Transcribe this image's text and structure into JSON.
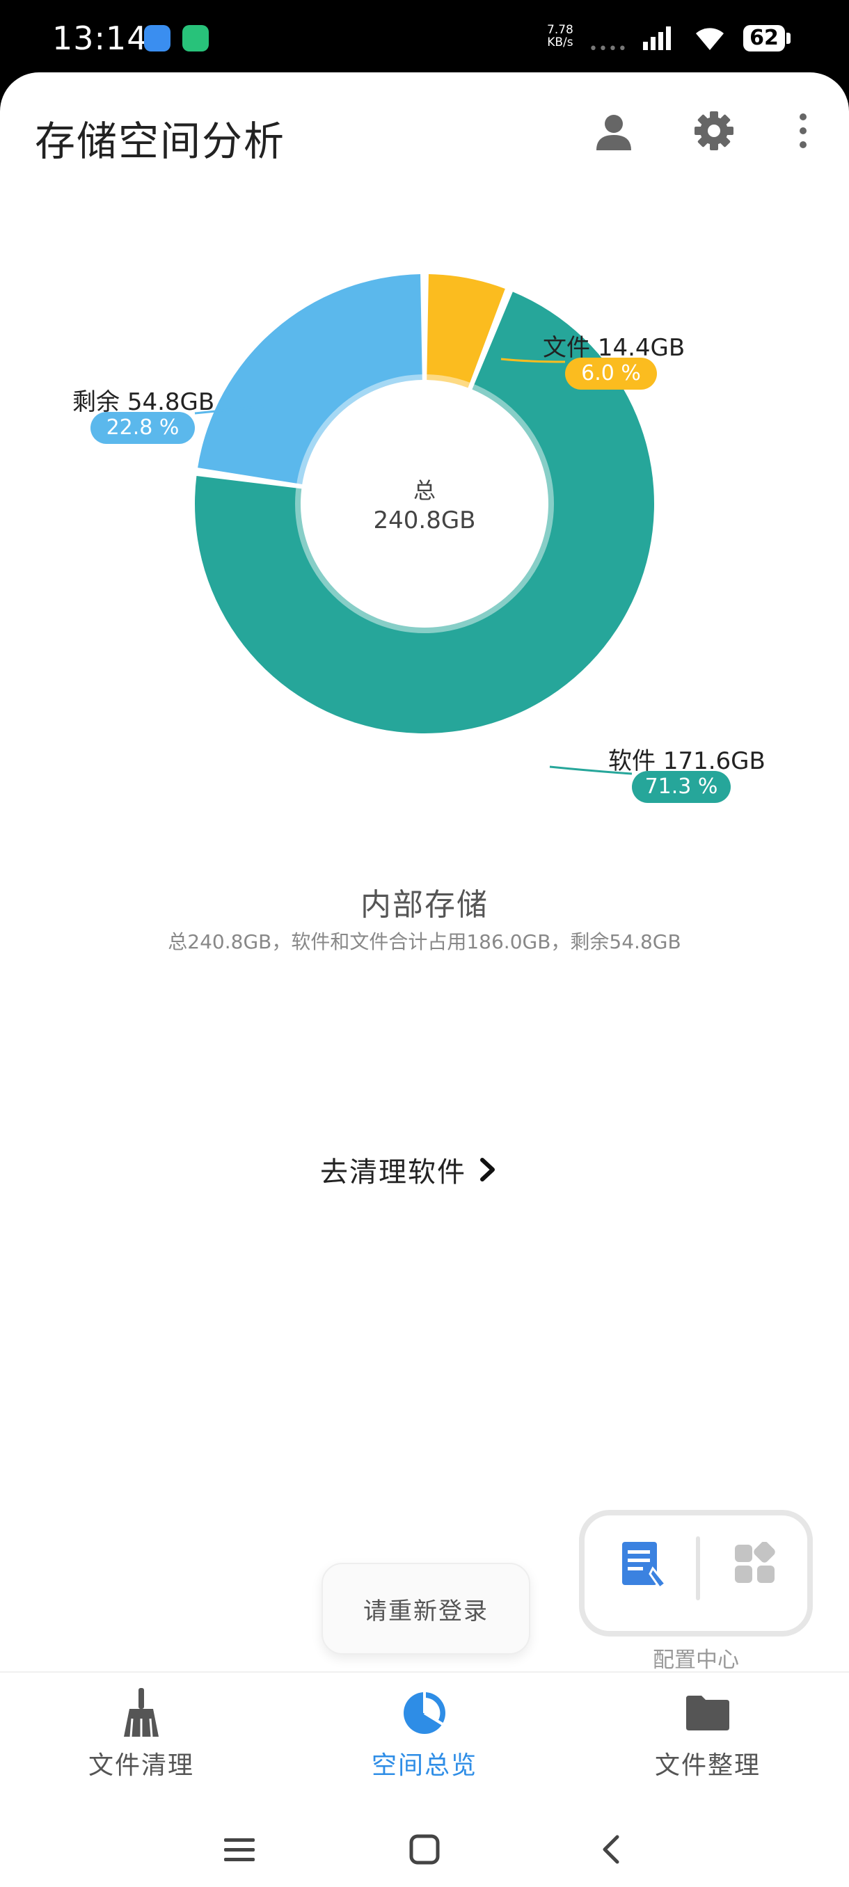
{
  "status_bar": {
    "time": "13:14",
    "net_speed_value": "7.78",
    "net_speed_unit": "KB/s",
    "battery": "62"
  },
  "header": {
    "title": "存储空间分析",
    "icons": [
      "user-icon",
      "gear-icon",
      "more-vert-icon"
    ]
  },
  "chart_data": {
    "type": "pie",
    "center_title": "总",
    "center_value": "240.8GB",
    "slices": [
      {
        "name": "文件",
        "size_label": "14.4GB",
        "percent": 6.0,
        "percent_label": "6.0 %",
        "color": "#FBBC1F"
      },
      {
        "name": "软件",
        "size_label": "171.6GB",
        "percent": 71.3,
        "percent_label": "71.3 %",
        "color": "#26A69A"
      },
      {
        "name": "剩余",
        "size_label": "54.8GB",
        "percent": 22.8,
        "percent_label": "22.8 %",
        "color": "#5BB8EC"
      }
    ]
  },
  "storage": {
    "title": "内部存储",
    "summary": "总240.8GB，软件和文件合计占用186.0GB，剩余54.8GB"
  },
  "clean_link": {
    "label": "去清理软件"
  },
  "config": {
    "caption": "配置中心"
  },
  "toast": {
    "text": "请重新登录"
  },
  "bottom_nav": {
    "items": [
      {
        "label": "文件清理",
        "icon": "broom-icon",
        "active": false
      },
      {
        "label": "空间总览",
        "icon": "pie-chart-icon",
        "active": true
      },
      {
        "label": "文件整理",
        "icon": "folder-icon",
        "active": false
      }
    ]
  },
  "colors": {
    "accent": "#2E8DE6",
    "nav_inactive": "#555555",
    "icon_gray": "#666666"
  }
}
